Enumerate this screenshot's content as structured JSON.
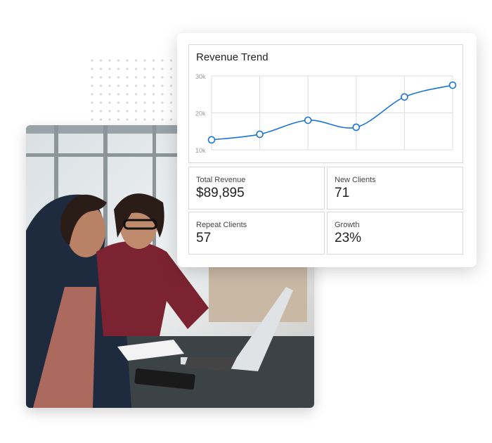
{
  "card": {
    "chart": {
      "title": "Revenue Trend"
    },
    "stats": [
      {
        "label": "Total Revenue",
        "value": "$89,895"
      },
      {
        "label": "New Clients",
        "value": "71"
      },
      {
        "label": "Repeat Clients",
        "value": "57"
      },
      {
        "label": "Growth",
        "value": "23%"
      }
    ]
  },
  "chart_data": {
    "type": "line",
    "title": "Revenue Trend",
    "x": [
      1,
      2,
      3,
      4,
      5,
      6
    ],
    "values": [
      12.7,
      14.2,
      18.0,
      16.1,
      24.3,
      27.5
    ],
    "ylim": [
      10,
      30
    ],
    "yticks": [
      "10k",
      "20k",
      "30k"
    ],
    "grid": true,
    "smooth": true,
    "line_color": "#1a73d9"
  },
  "photo": {
    "description_icon": "photo-two-women-laptop"
  }
}
